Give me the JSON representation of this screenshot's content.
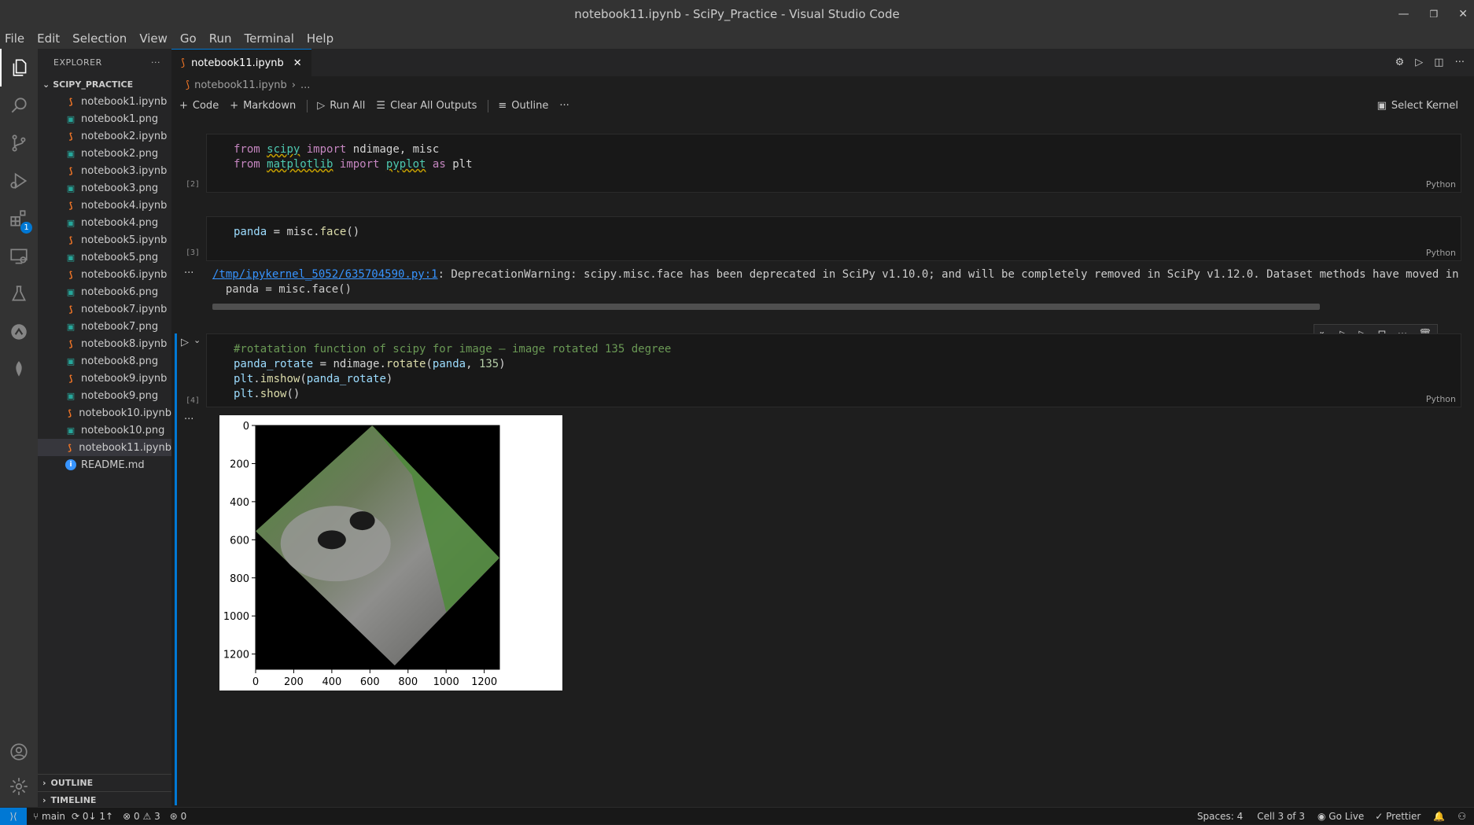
{
  "window": {
    "title": "notebook11.ipynb - SciPy_Practice - Visual Studio Code"
  },
  "menu": [
    "File",
    "Edit",
    "Selection",
    "View",
    "Go",
    "Run",
    "Terminal",
    "Help"
  ],
  "activity": {
    "extensions_badge": "1"
  },
  "explorer": {
    "header": "EXPLORER",
    "folder": "SCIPY_PRACTICE",
    "files": [
      {
        "name": "notebook1.ipynb",
        "type": "ipynb"
      },
      {
        "name": "notebook1.png",
        "type": "png"
      },
      {
        "name": "notebook2.ipynb",
        "type": "ipynb"
      },
      {
        "name": "notebook2.png",
        "type": "png"
      },
      {
        "name": "notebook3.ipynb",
        "type": "ipynb"
      },
      {
        "name": "notebook3.png",
        "type": "png"
      },
      {
        "name": "notebook4.ipynb",
        "type": "ipynb"
      },
      {
        "name": "notebook4.png",
        "type": "png"
      },
      {
        "name": "notebook5.ipynb",
        "type": "ipynb"
      },
      {
        "name": "notebook5.png",
        "type": "png"
      },
      {
        "name": "notebook6.ipynb",
        "type": "ipynb"
      },
      {
        "name": "notebook6.png",
        "type": "png"
      },
      {
        "name": "notebook7.ipynb",
        "type": "ipynb"
      },
      {
        "name": "notebook7.png",
        "type": "png"
      },
      {
        "name": "notebook8.ipynb",
        "type": "ipynb"
      },
      {
        "name": "notebook8.png",
        "type": "png"
      },
      {
        "name": "notebook9.ipynb",
        "type": "ipynb"
      },
      {
        "name": "notebook9.png",
        "type": "png"
      },
      {
        "name": "notebook10.ipynb",
        "type": "ipynb"
      },
      {
        "name": "notebook10.png",
        "type": "png"
      },
      {
        "name": "notebook11.ipynb",
        "type": "ipynb",
        "selected": true
      },
      {
        "name": "README.md",
        "type": "md"
      }
    ],
    "outline": "OUTLINE",
    "timeline": "TIMELINE"
  },
  "tab": {
    "label": "notebook11.ipynb"
  },
  "breadcrumb": {
    "file": "notebook11.ipynb",
    "rest": "..."
  },
  "toolbar": {
    "code": "Code",
    "markdown": "Markdown",
    "run_all": "Run All",
    "clear": "Clear All Outputs",
    "outline": "Outline",
    "kernel": "Select Kernel"
  },
  "cells": [
    {
      "exec": "[2]",
      "lang": "Python"
    },
    {
      "exec": "[3]",
      "lang": "Python",
      "output": {
        "link": "/tmp/ipykernel_5052/635704590.py:1",
        "message": ": DeprecationWarning: scipy.misc.face has been deprecated in SciPy v1.10.0; and will be completely removed in SciPy v1.12.0. Dataset methods have moved in",
        "line2": "  panda = misc.face()"
      }
    },
    {
      "exec": "[4]",
      "lang": "Python"
    }
  ],
  "chart_data": {
    "type": "image",
    "xticks": [
      "0",
      "200",
      "400",
      "600",
      "800",
      "1000",
      "1200"
    ],
    "yticks": [
      "0",
      "200",
      "400",
      "600",
      "800",
      "1000",
      "1200"
    ],
    "xlim": [
      0,
      1280
    ],
    "ylim": [
      1280,
      0
    ],
    "image_colors": {
      "background": "#000000",
      "foliage": "#4d8a3a",
      "fur": "#8e8e8c"
    }
  },
  "status": {
    "branch": "main",
    "sync": "0↓ 1↑",
    "problems": "0",
    "warnings": "3",
    "ports": "0",
    "spaces": "Spaces: 4",
    "cell": "Cell 3 of 3",
    "golive": "Go Live",
    "prettier": "Prettier"
  }
}
